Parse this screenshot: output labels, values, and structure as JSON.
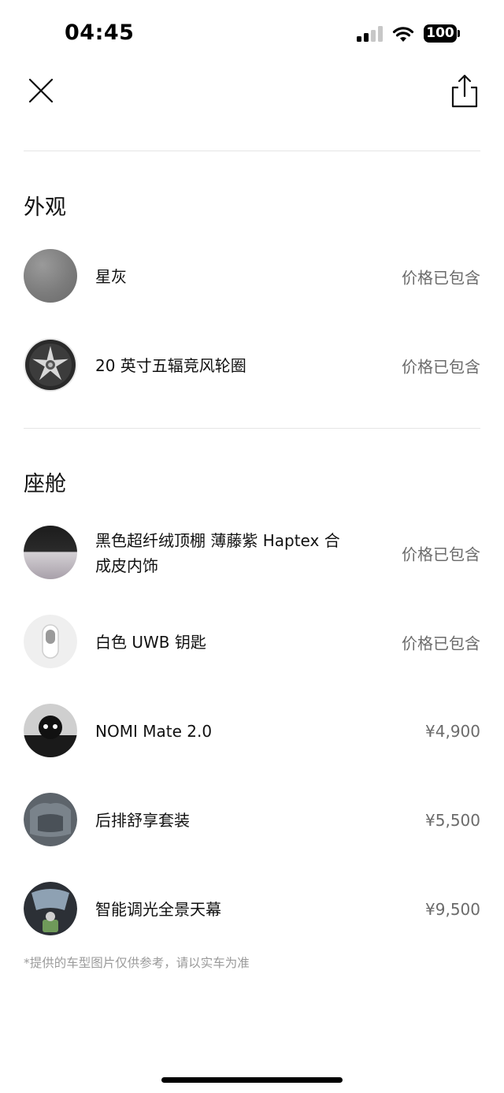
{
  "status_bar": {
    "time": "04:45",
    "battery": "100"
  },
  "nav": {
    "close_icon": "close-x-icon",
    "share_icon": "share-icon"
  },
  "sections": {
    "exterior": {
      "title": "外观",
      "items": [
        {
          "name": "星灰",
          "price": "价格已包含"
        },
        {
          "name": "20 英寸五辐竞风轮圈",
          "price": "价格已包含"
        }
      ]
    },
    "cabin": {
      "title": "座舱",
      "items": [
        {
          "name": "黑色超纤绒顶棚 薄藤紫 Haptex 合成皮内饰",
          "price": "价格已包含"
        },
        {
          "name": "白色 UWB 钥匙",
          "price": "价格已包含"
        },
        {
          "name": "NOMI Mate 2.0",
          "price": "¥4,900"
        },
        {
          "name": "后排舒享套装",
          "price": "¥5,500"
        },
        {
          "name": "智能调光全景天幕",
          "price": "¥9,500"
        }
      ]
    }
  },
  "disclaimer": "*提供的车型图片仅供参考，请以实车为准",
  "colors": {
    "text": "#111111",
    "price": "#6b6b6b",
    "divider": "#e5e5e5",
    "disclaimer": "#9a9a9a"
  }
}
